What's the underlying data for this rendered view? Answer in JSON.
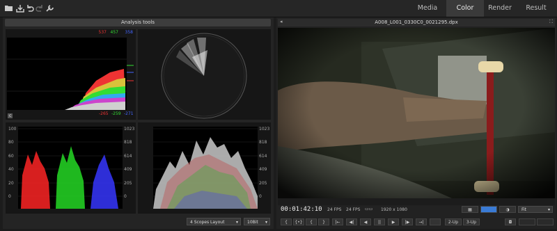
{
  "tabs": [
    {
      "label": "Media"
    },
    {
      "label": "Color"
    },
    {
      "label": "Render"
    },
    {
      "label": "Result"
    }
  ],
  "analysis": {
    "title": "Analysis tools",
    "hist_top": {
      "r": "537",
      "g": "457",
      "b": "358"
    },
    "hist_bottom": {
      "r": "-265",
      "g": "-259",
      "b": "-271"
    },
    "hist_marks": [
      "685",
      "95"
    ],
    "hist_c": "c",
    "scale_labels": [
      "1023",
      "818",
      "614",
      "409",
      "205",
      "0"
    ],
    "left_labels": [
      "100",
      "80",
      "60",
      "40",
      "20",
      "0"
    ]
  },
  "layout_select": "4 Scopes Layout",
  "bit_select": "10Bit",
  "viewer": {
    "filename": "A008_L001_0330C0_0021295.dpx",
    "timecode": "00:01:42:10",
    "fps1": "24 FPS",
    "fps2": "24 FPS",
    "resolution": "1920 x 1080",
    "zoom": "Fit"
  },
  "transport": [
    "{",
    "{•}",
    "{",
    "}",
    "|←",
    "◀|",
    "◀",
    "||",
    "▶",
    "|▶",
    "→|",
    "",
    "2-Up",
    "3-Up"
  ],
  "colors": {
    "red": "#e33",
    "green": "#3d3",
    "blue": "#46f",
    "accent": "#3a7bd5"
  }
}
